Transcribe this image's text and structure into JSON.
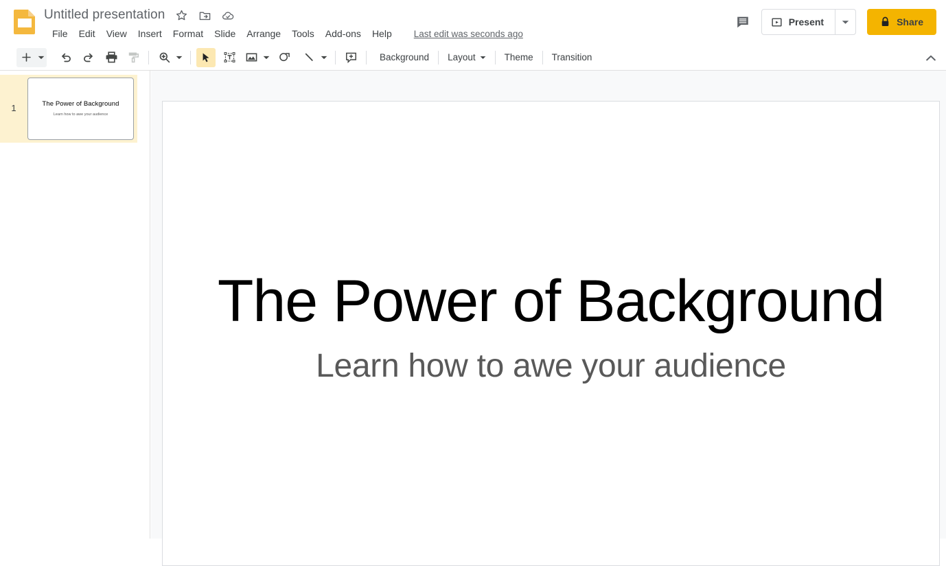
{
  "app": {
    "name": "Google Slides",
    "logo_icon": "slides-logo-icon",
    "brand_color": "#f4b400"
  },
  "topbar": {
    "doc_title": "Untitled presentation",
    "title_icons": [
      {
        "name": "star-icon",
        "label": "Star"
      },
      {
        "name": "move-to-folder-icon",
        "label": "Move to folder"
      },
      {
        "name": "cloud-saved-icon",
        "label": "See document status"
      }
    ],
    "menus": [
      "File",
      "Edit",
      "View",
      "Insert",
      "Format",
      "Slide",
      "Arrange",
      "Tools",
      "Add-ons",
      "Help"
    ],
    "last_edit": "Last edit was seconds ago",
    "comment_icon": "comment-icon",
    "present_label": "Present",
    "present_icon": "present-play-icon",
    "present_caret_icon": "chevron-down-icon",
    "share_label": "Share",
    "share_icon": "lock-icon",
    "share_bg": "#f4b400"
  },
  "toolbar": {
    "items": [
      {
        "name": "new-slide-button",
        "icon": "plus-icon",
        "label": "New slide"
      },
      {
        "name": "new-slide-caret",
        "icon": "chevron-down-icon",
        "label": "New slide options"
      },
      {
        "name": "undo-button",
        "icon": "undo-icon",
        "label": "Undo"
      },
      {
        "name": "redo-button",
        "icon": "redo-icon",
        "label": "Redo"
      },
      {
        "name": "print-button",
        "icon": "print-icon",
        "label": "Print"
      },
      {
        "name": "paint-format-button",
        "icon": "paint-format-icon",
        "label": "Paint format"
      },
      {
        "name": "zoom-button",
        "icon": "zoom-in-icon",
        "label": "Zoom"
      },
      {
        "name": "zoom-caret",
        "icon": "chevron-down-icon",
        "label": "Zoom options"
      },
      {
        "name": "select-tool-button",
        "icon": "cursor-arrow-icon",
        "label": "Select"
      },
      {
        "name": "text-box-button",
        "icon": "text-box-icon",
        "label": "Text box"
      },
      {
        "name": "insert-image-button",
        "icon": "image-icon",
        "label": "Insert image"
      },
      {
        "name": "insert-image-caret",
        "icon": "chevron-down-icon",
        "label": "Image options"
      },
      {
        "name": "shape-button",
        "icon": "shape-icon",
        "label": "Shape"
      },
      {
        "name": "line-button",
        "icon": "line-icon",
        "label": "Line"
      },
      {
        "name": "line-caret",
        "icon": "chevron-down-icon",
        "label": "Line options"
      },
      {
        "name": "add-comment-button",
        "icon": "add-comment-icon",
        "label": "Add comment"
      }
    ],
    "background_label": "Background",
    "layout_label": "Layout",
    "layout_caret_icon": "chevron-down-icon",
    "theme_label": "Theme",
    "transition_label": "Transition",
    "collapse_icon": "chevron-up-icon",
    "collapse_label": "Hide the menus"
  },
  "filmstrip": {
    "slides": [
      {
        "number": "1",
        "title": "The Power of Background",
        "subtitle": "Learn how to awe your audience",
        "selected": true
      }
    ]
  },
  "slide": {
    "title": "The Power of Background",
    "subtitle": "Learn how to awe your audience",
    "title_color": "#000000",
    "subtitle_color": "#595959",
    "background": "#ffffff"
  }
}
